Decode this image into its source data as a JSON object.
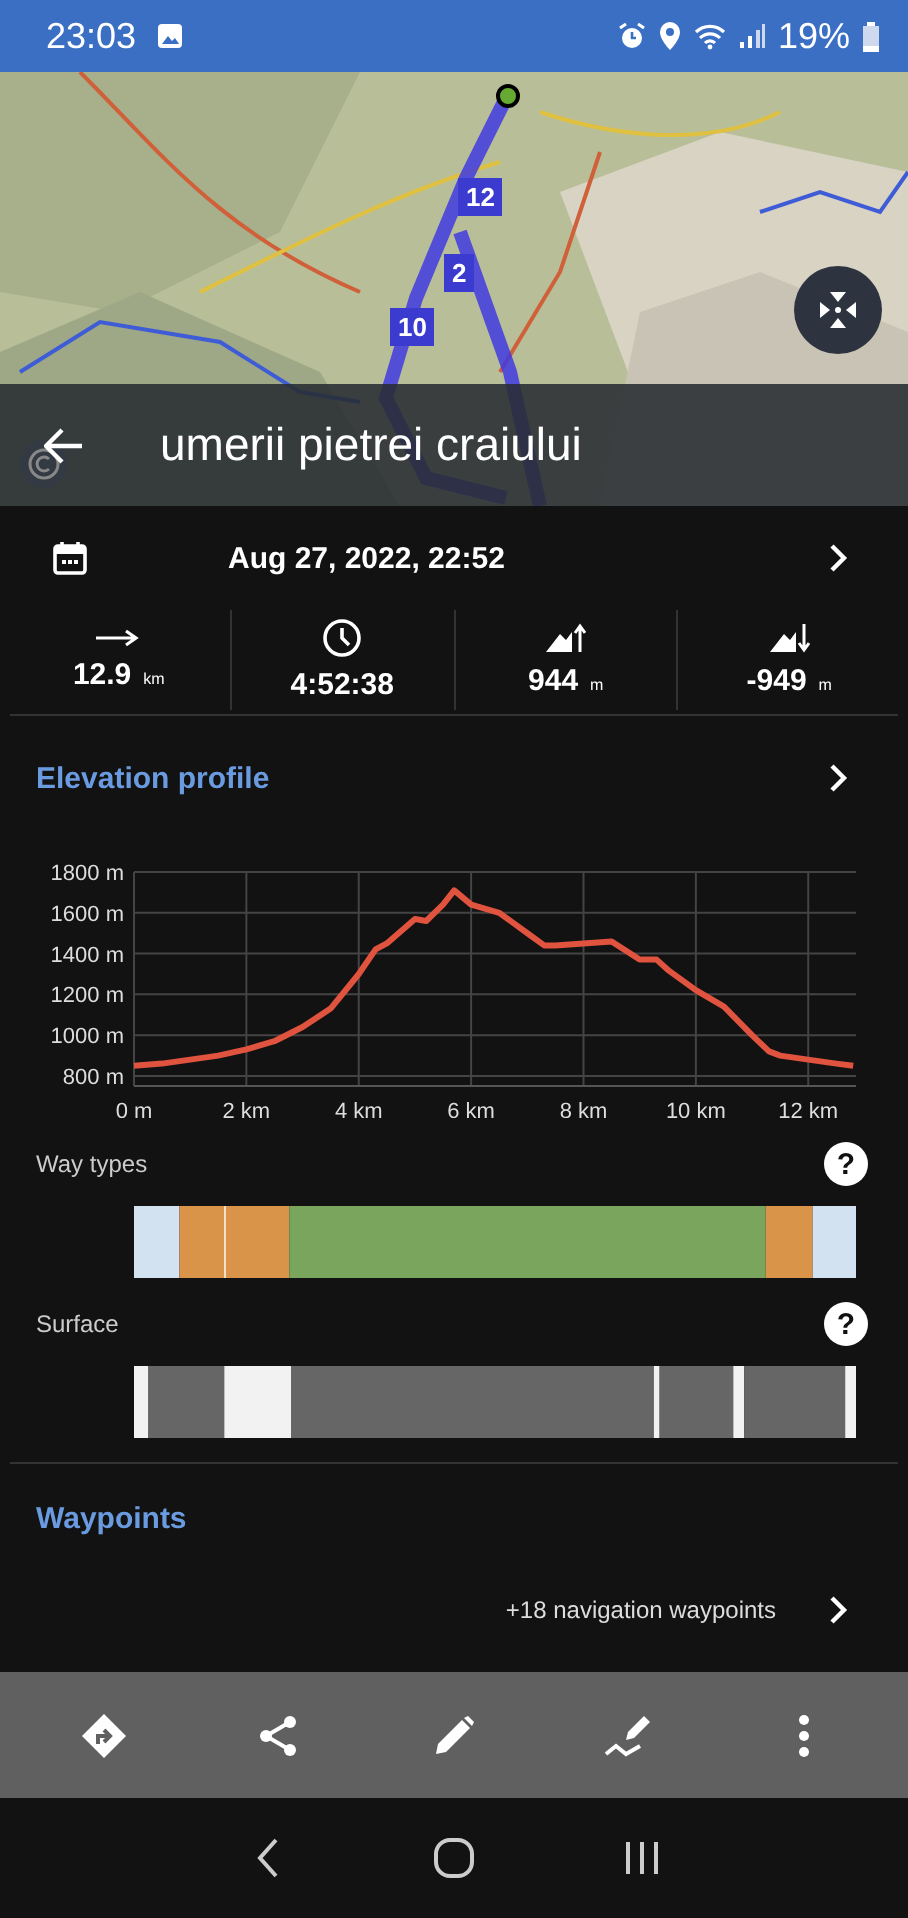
{
  "status_bar": {
    "time": "23:03",
    "battery": "19%"
  },
  "map": {
    "route_markers": [
      {
        "label": "12"
      },
      {
        "label": "2"
      },
      {
        "label": "10"
      }
    ]
  },
  "header": {
    "title": "umerii pietrei craiului"
  },
  "date": {
    "text": "Aug 27, 2022, 22:52"
  },
  "stats": [
    {
      "kind": "distance",
      "value": "12.9",
      "unit": "km"
    },
    {
      "kind": "duration",
      "value": "4:52:38"
    },
    {
      "kind": "ascent",
      "value": "944",
      "unit": "m"
    },
    {
      "kind": "descent",
      "value": "-949",
      "unit": "m"
    }
  ],
  "elevation": {
    "title": "Elevation profile",
    "chart_data": {
      "type": "line",
      "x": [
        0,
        0.5,
        1,
        1.5,
        2,
        2.5,
        3,
        3.5,
        4,
        4.3,
        4.5,
        5,
        5.2,
        5.5,
        5.7,
        6,
        6.5,
        7,
        7.3,
        7.5,
        8,
        8.5,
        9,
        9.3,
        9.5,
        10,
        10.5,
        11,
        11.3,
        11.5,
        12,
        12.5,
        12.8
      ],
      "series": [
        {
          "color": "#e0533f",
          "values": [
            850,
            860,
            880,
            900,
            930,
            970,
            1040,
            1130,
            1300,
            1420,
            1450,
            1570,
            1560,
            1640,
            1710,
            1640,
            1600,
            1500,
            1440,
            1440,
            1450,
            1460,
            1370,
            1370,
            1320,
            1220,
            1140,
            1000,
            920,
            900,
            880,
            860,
            850
          ]
        }
      ],
      "grid": true,
      "xlim": [
        0,
        12.85
      ],
      "ylim": [
        780,
        1800
      ],
      "xticks": [
        {
          "value": 0,
          "label": "0 m"
        },
        {
          "value": 2,
          "label": "2 km"
        },
        {
          "value": 4,
          "label": "4 km"
        },
        {
          "value": 6,
          "label": "6 km"
        },
        {
          "value": 8,
          "label": "8 km"
        },
        {
          "value": 10,
          "label": "10 km"
        },
        {
          "value": 12,
          "label": "12 km"
        }
      ],
      "yticks": [
        {
          "value": 800,
          "label": "800 m"
        },
        {
          "value": 1000,
          "label": "1000 m"
        },
        {
          "value": 1200,
          "label": "1200 m"
        },
        {
          "value": 1400,
          "label": "1400 m"
        },
        {
          "value": 1600,
          "label": "1600 m"
        },
        {
          "value": 1800,
          "label": "1800 m"
        }
      ]
    }
  },
  "way_types": {
    "label": "Way types",
    "help": "?"
  },
  "surface": {
    "label": "Surface",
    "help": "?"
  },
  "waypoints": {
    "title": "Waypoints",
    "more": "+18 navigation waypoints"
  },
  "toolbar": [
    {
      "kind": "navigate"
    },
    {
      "kind": "share"
    },
    {
      "kind": "edit"
    },
    {
      "kind": "draw"
    },
    {
      "kind": "more"
    }
  ]
}
